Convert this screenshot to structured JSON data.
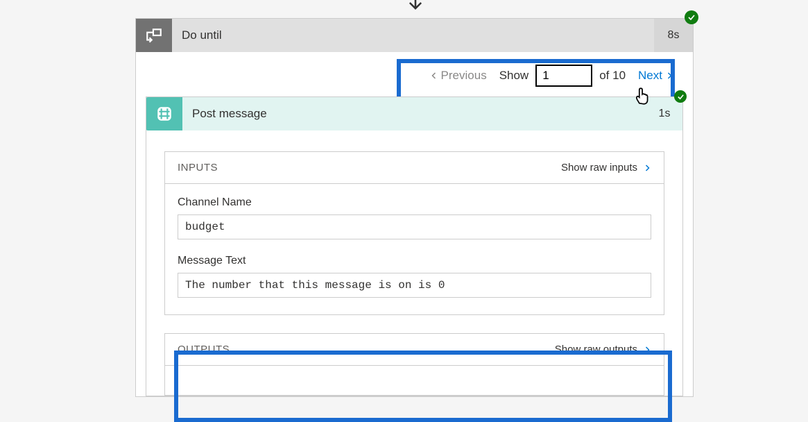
{
  "doUntil": {
    "title": "Do until",
    "duration": "8s"
  },
  "pagination": {
    "previous": "Previous",
    "showLabel": "Show",
    "currentPage": "1",
    "ofLabel": "of 10",
    "next": "Next"
  },
  "postMessage": {
    "title": "Post message",
    "duration": "1s"
  },
  "inputs": {
    "header": "INPUTS",
    "showRaw": "Show raw inputs",
    "channelName": {
      "label": "Channel Name",
      "value": "budget"
    },
    "messageText": {
      "label": "Message Text",
      "value": "The number that this message is on is 0"
    }
  },
  "outputs": {
    "header": "OUTPUTS",
    "showRaw": "Show raw outputs"
  }
}
